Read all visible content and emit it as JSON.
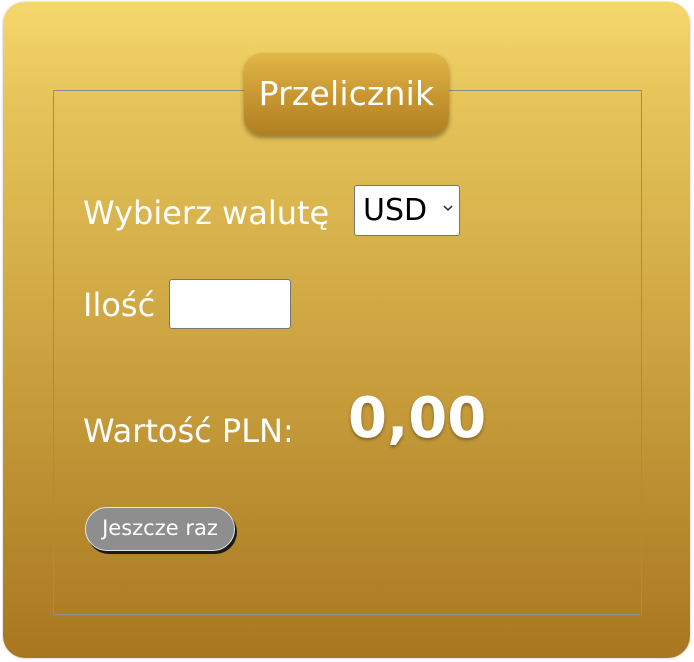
{
  "panel": {
    "legend": "Przelicznik",
    "currency_label": "Wybierz walutę",
    "currency_selected": "USD",
    "amount_label": "Ilość",
    "amount_value": "",
    "result_label": "Wartość PLN:",
    "result_value": "0,00",
    "reset_button": "Jeszcze raz"
  },
  "icons": {
    "select_arrow": "chevron-down-icon"
  },
  "colors": {
    "gradient_top": "#f5d86b",
    "gradient_bottom": "#a8771f",
    "legend_bg": "#c79530",
    "button_bg": "#8e8e8e",
    "text": "#ffffff"
  }
}
